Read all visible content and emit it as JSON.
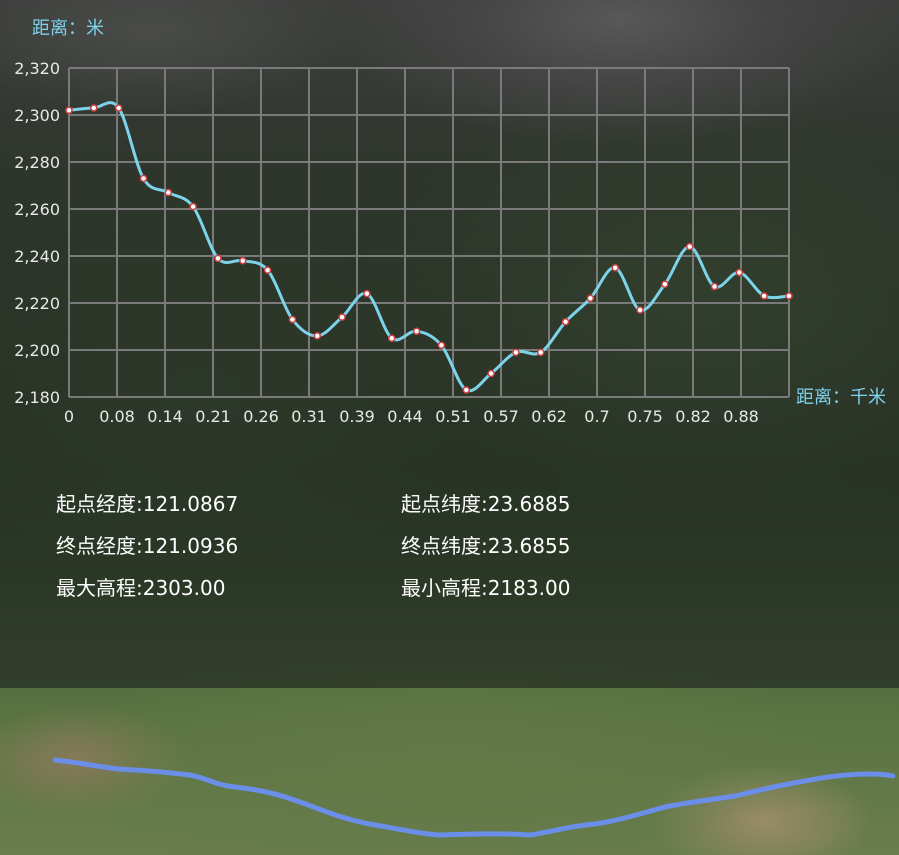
{
  "chart_data": {
    "type": "line",
    "ylabel": "距离：米",
    "xlabel": "距离：千米",
    "ylim": [
      2180,
      2320
    ],
    "yticks": [
      "2,180",
      "2,200",
      "2,220",
      "2,240",
      "2,260",
      "2,280",
      "2,300",
      "2,320"
    ],
    "xticks": [
      "0",
      "0.08",
      "0.14",
      "0.21",
      "0.26",
      "0.31",
      "0.39",
      "0.44",
      "0.51",
      "0.57",
      "0.62",
      "0.7",
      "0.75",
      "0.82",
      "0.88"
    ],
    "series": [
      {
        "color": "#7dd3ea",
        "values": [
          2302,
          2303,
          2303,
          2273,
          2267,
          2261,
          2239,
          2238,
          2234,
          2213,
          2206,
          2214,
          2224,
          2205,
          2208,
          2202,
          2183,
          2190,
          2199,
          2199,
          2212,
          2222,
          2235,
          2217,
          2228,
          2244,
          2227,
          2233,
          2223,
          2223
        ]
      }
    ],
    "grid": true,
    "colors": {
      "axis_label": "#7fd0ea",
      "tick": "#e8e8e8",
      "grid": "#7a7a7a",
      "marker_fill": "#ffffff",
      "marker_stroke": "#d04040"
    }
  },
  "info": {
    "start_lon": "起点经度:121.0867",
    "start_lat": "起点纬度:23.6885",
    "end_lon": "终点经度:121.0936",
    "end_lat": "终点纬度:23.6855",
    "max_elev": "最大高程:2303.00",
    "min_elev": "最小高程:2183.00"
  },
  "route": {
    "color": "#6b8ee8"
  }
}
